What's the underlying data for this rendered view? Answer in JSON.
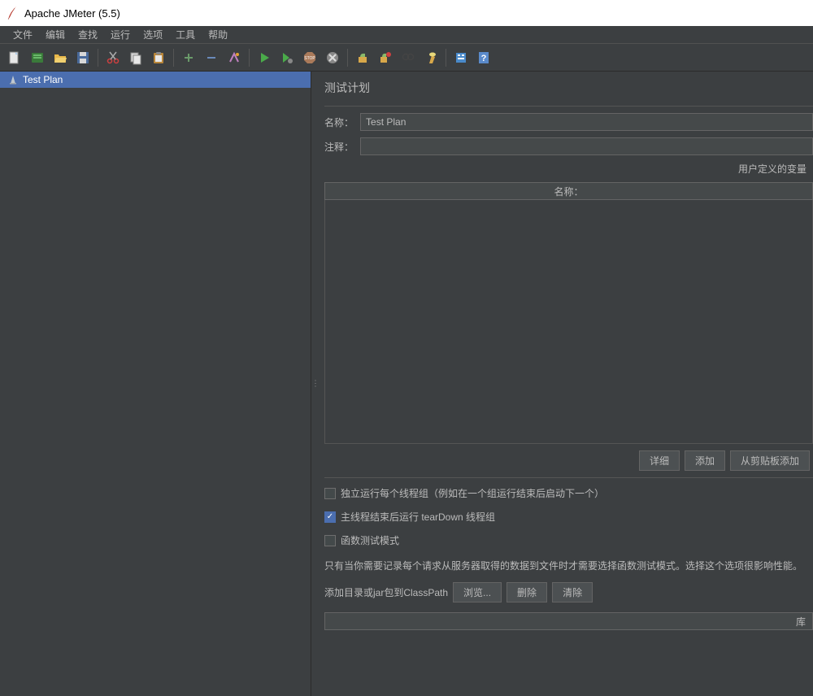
{
  "window": {
    "title": "Apache JMeter (5.5)"
  },
  "menu": {
    "file": "文件",
    "edit": "编辑",
    "search": "查找",
    "run": "运行",
    "options": "选项",
    "tools": "工具",
    "help": "帮助"
  },
  "tree": {
    "root": "Test Plan"
  },
  "panel": {
    "title": "测试计划",
    "name_label": "名称：",
    "name_value": "Test Plan",
    "comment_label": "注释：",
    "comment_value": "",
    "vars_title": "用户定义的变量",
    "vars_col_name": "名称：",
    "btn_detail": "详细",
    "btn_add": "添加",
    "btn_paste": "从剪贴板添加",
    "chk_serial": "独立运行每个线程组（例如在一个组运行结束后启动下一个）",
    "chk_teardown": "主线程结束后运行 tearDown 线程组",
    "chk_functional": "函数测试模式",
    "functional_desc": "只有当你需要记录每个请求从服务器取得的数据到文件时才需要选择函数测试模式。选择这个选项很影响性能。",
    "classpath_label": "添加目录或jar包到ClassPath",
    "btn_browse": "浏览...",
    "btn_delete": "删除",
    "btn_clear": "清除",
    "classpath_col": "库"
  }
}
